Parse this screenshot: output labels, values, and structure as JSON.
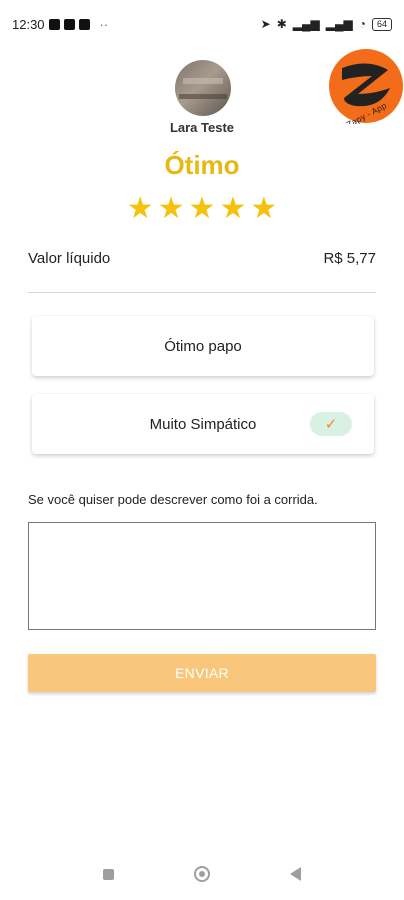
{
  "status_bar": {
    "time": "12:30",
    "dots": "··",
    "battery": "64",
    "icons": [
      "location-icon",
      "bluetooth-icon",
      "signal-icon",
      "signal-icon",
      "wifi-icon",
      "battery-icon"
    ]
  },
  "driver": {
    "name": "Lara Teste",
    "rating_word": "Ótimo",
    "stars": 5
  },
  "logo": {
    "text": "Zapy - App",
    "colors": {
      "primary": "#f26c1a",
      "secondary": "#222222"
    }
  },
  "fare": {
    "label": "Valor líquido",
    "value": "R$ 5,77"
  },
  "options": [
    {
      "label": "Ótimo papo",
      "selected": false
    },
    {
      "label": "Muito Simpático",
      "selected": true
    }
  ],
  "comment": {
    "prompt": "Se você quiser pode descrever como foi a corrida.",
    "value": ""
  },
  "actions": {
    "send_label": "ENVIAR"
  },
  "colors": {
    "accent": "#e6b812",
    "star": "#f4c20d",
    "button": "#f9c77b",
    "check_bg": "#d9f1e2",
    "check": "#f28c28"
  }
}
